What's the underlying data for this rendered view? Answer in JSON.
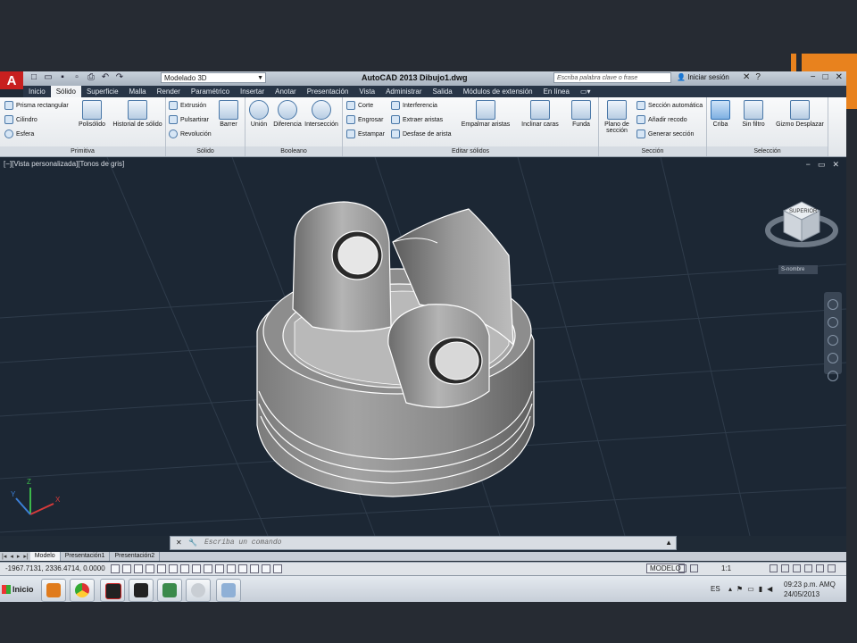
{
  "titlebar": {
    "app_logo": "A",
    "workspace": "Modelado 3D",
    "title": "AutoCAD 2013   Dibujo1.dwg",
    "search_placeholder": "Escriba palabra clave o frase",
    "signin": "Iniciar sesión"
  },
  "tabs": [
    "Inicio",
    "Sólido",
    "Superficie",
    "Malla",
    "Render",
    "Paramétrico",
    "Insertar",
    "Anotar",
    "Presentación",
    "Vista",
    "Administrar",
    "Salida",
    "Módulos de extensión",
    "En línea"
  ],
  "active_tab": "Sólido",
  "ribbon": {
    "primitiva": {
      "title": "Primitiva",
      "prisma": "Prisma rectangular",
      "cilindro": "Cilindro",
      "esfera": "Esfera",
      "polisolido": "Polisólido",
      "historial": "Historial de sólido"
    },
    "solido": {
      "title": "Sólido",
      "extrusion": "Extrusión",
      "pulsartirar": "Pulsartirar",
      "revolucion": "Revolución",
      "barrer": "Barrer"
    },
    "booleano": {
      "title": "Booleano",
      "union": "Unión",
      "diferencia": "Diferencia",
      "interseccion": "Intersección"
    },
    "editar": {
      "title": "Editar sólidos",
      "corte": "Corte",
      "engrosar": "Engrosar",
      "estampar": "Estampar",
      "interferencia": "Interferencia",
      "extraer": "Extraer aristas",
      "desfase": "Desfase de arista",
      "empalmar": "Empalmar aristas",
      "inclinar": "Inclinar caras",
      "funda": "Funda"
    },
    "seccion": {
      "title": "Sección",
      "plano": "Plano de sección",
      "automatica": "Sección automática",
      "recodo": "Añadir recodo",
      "generar": "Generar sección"
    },
    "seleccion": {
      "title": "Selección",
      "criba": "Criba",
      "sinfiltro": "Sin filtro",
      "gizmo": "Gizmo Desplazar"
    }
  },
  "viewport": {
    "label": "[−][Vista personalizada][Tonos de gris]",
    "viewcube_face": "SUPERIOR",
    "wcs": "S-nombre"
  },
  "cmdline": {
    "placeholder": "Escriba un comando"
  },
  "layout_tabs": [
    "Modelo",
    "Presentación1",
    "Presentación2"
  ],
  "status": {
    "coords": "-1967.7131, 2336.4714, 0.0000",
    "model": "MODELO",
    "scale": "1:1"
  },
  "taskbar": {
    "start": "Inicio",
    "lang": "ES",
    "time": "09:23 p.m. AMQ",
    "date": "24/05/2013"
  },
  "colors": {
    "accent": "#e8821e",
    "viewport_bg": "#1c2734",
    "ribbon_tab_bg": "#283546"
  }
}
